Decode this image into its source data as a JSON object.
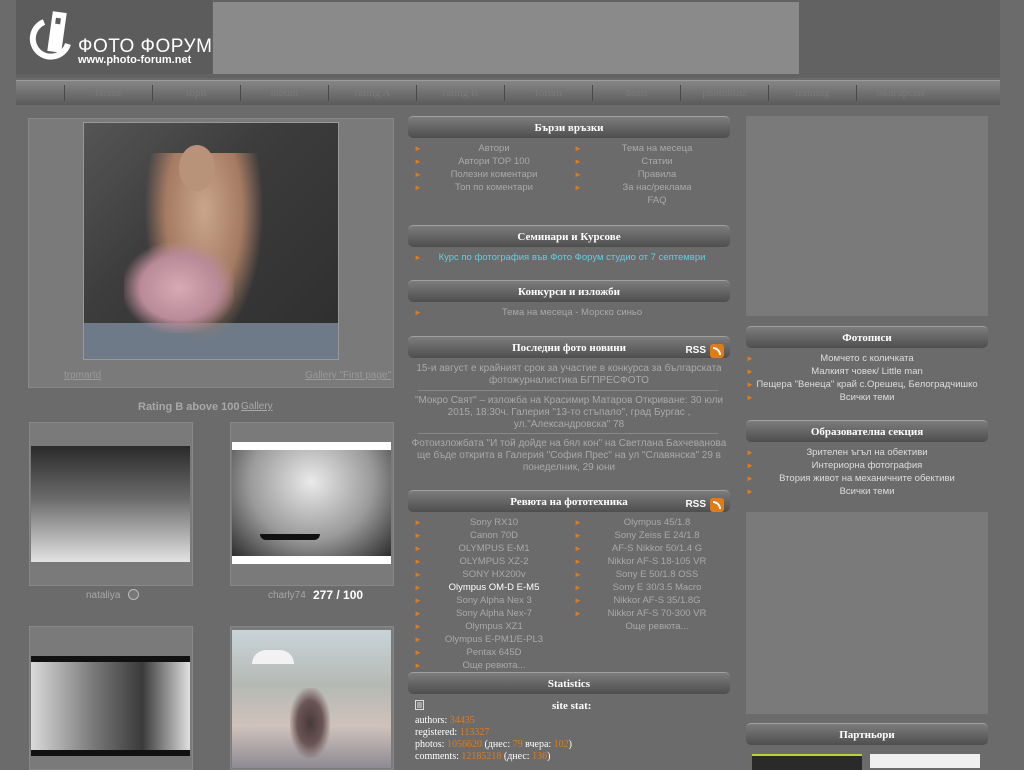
{
  "header": {
    "logo_title": "ФОТО ФОРУМ",
    "logo_url": "www.photo-forum.net"
  },
  "nav": [
    "Home",
    "topli",
    "album",
    "rating A",
    "rating B",
    "forum",
    "bozo",
    "photoblitz",
    "training",
    "български"
  ],
  "featured": {
    "author": "trpmartd",
    "gallery_link": "Gallery \"First page\"",
    "rating_title": "Rating B above 100",
    "rating_link": "Gallery"
  },
  "thumbs": {
    "t1_author": "nataliya",
    "t2_author": "charly74",
    "t2_score": "277",
    "t2_score_max": "100"
  },
  "quick_links": {
    "title": "Бързи връзки",
    "left": [
      "Автори",
      "Автори ТОР 100",
      "Полезни коментари",
      "Топ по коментари"
    ],
    "right": [
      "Тема на месеца",
      "Статии",
      "Правила",
      "За нас/реклама",
      "FAQ"
    ]
  },
  "seminars": {
    "title": "Семинари и Курсове",
    "item": "Курс по фотография във Фото Форум студио от 7 септември"
  },
  "contests": {
    "title": "Конкурси и изложби",
    "item": "Тема на месеца - Морско синьо"
  },
  "news": {
    "title": "Последни фото новини",
    "rss": "RSS",
    "items": [
      "15-и август е крайният срок за участие в конкурса за българската фотожурналистика БГПРЕСФОТО",
      "\"Мокро Свят\" – изложба на Красимир Матаров Откриване: 30 юли 2015, 18:30ч. Галерия \"13-то стъпало\", град Бургас , ул.\"Александровска\" 78",
      "Фотоизложбата \"И той дойде на бял кон\" на Светлана Бахчеванова ще бъде открита в Галерия \"София Прес\" на ул \"Славянска\" 29 в понеделник, 29 юни"
    ]
  },
  "reviews": {
    "title": "Ревюта на фототехника",
    "rss": "RSS",
    "left": [
      "Sony RX10",
      "Canon 70D",
      "OLYMPUS E-M1",
      "OLYMPUS XZ-2",
      "SONY HX200v",
      "Olympus OM-D E-M5",
      "Sony Alpha Nex 3",
      "Sony Alpha Nex-7",
      "Olympus XZ1",
      "Olympus E-PM1/E-PL3",
      "Pentax 645D",
      "Още ревюта..."
    ],
    "right": [
      "Olympus 45/1.8",
      "Sony Zeiss E 24/1.8",
      "AF-S Nikkor 50/1.4 G",
      "Nikkor AF-S 18-105 VR",
      "Sony E 50/1.8 OSS",
      "Sony E 30/3.5 Macro",
      "Nikkor AF-S 35/1.8G",
      "Nikkor AF-S 70-300 VR",
      "Още ревюта..."
    ]
  },
  "statistics": {
    "title": "Statistics",
    "site_stat": "site stat:",
    "authors_label": "authors:",
    "authors": "34435",
    "registered_label": "registered:",
    "registered": "113327",
    "photos_label": "photos:",
    "photos": "1056620",
    "photos_today_label": "(днес:",
    "photos_today": "79",
    "photos_yesterday_label": "вчера:",
    "photos_yesterday": "102",
    "comments_label": "comments:",
    "comments": "12185218",
    "comments_today_label": "(днес:",
    "comments_today": "136"
  },
  "photo_essays": {
    "title": "Фотописи",
    "items": [
      "Момчето с количката",
      "Малкият човек/ Little man",
      "Пещера \"Венеца\" край с.Орешец, Белоградчишко",
      "Всички теми"
    ]
  },
  "education": {
    "title": "Образователна секция",
    "items": [
      "Зрителен ъгъл на обективи",
      "Интериорна фотография",
      "Втория живот на механичните обективи",
      "Всички теми"
    ]
  },
  "partners": {
    "title": "Партньори"
  },
  "colors": {
    "accent": "#e07b18",
    "background": "#6b6b6b",
    "link_cyan": "#5fd0e0"
  }
}
